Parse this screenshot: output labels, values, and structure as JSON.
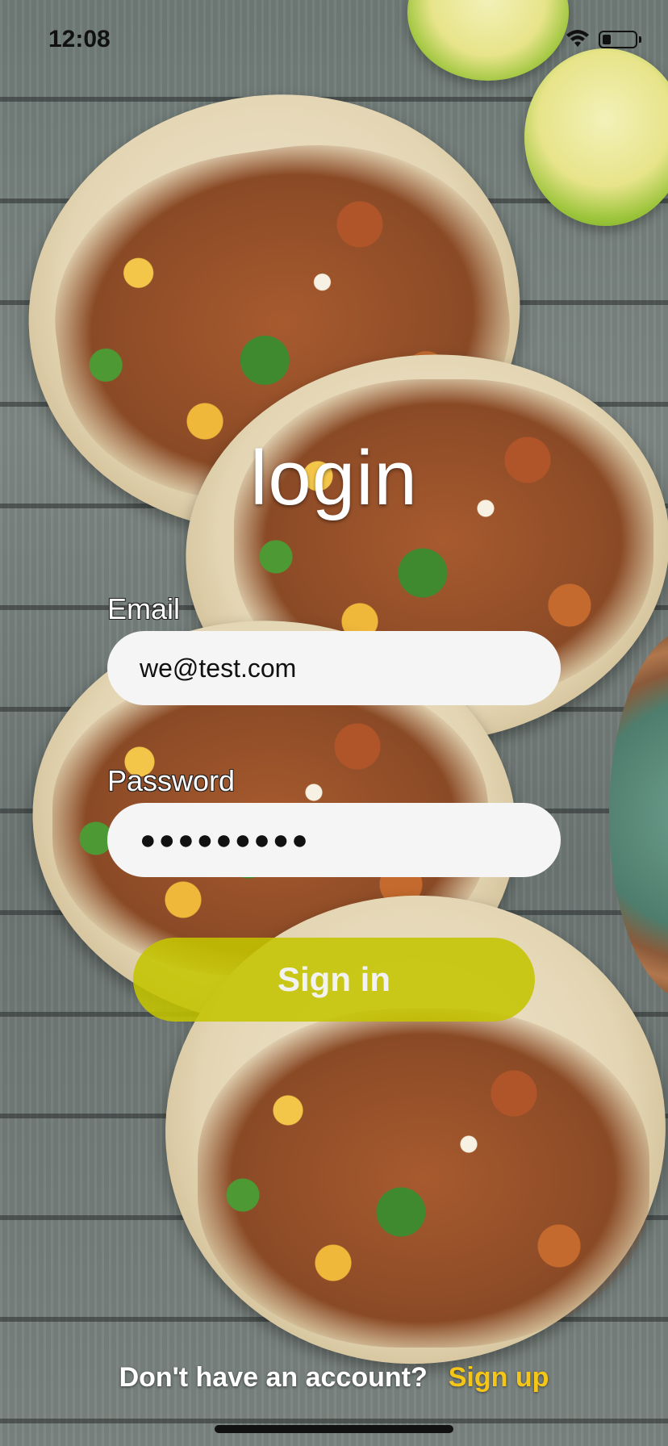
{
  "status_bar": {
    "time": "12:08",
    "wifi_icon": "wifi-icon",
    "battery_icon": "battery-icon"
  },
  "background": {
    "description_icon": "tacos-photo"
  },
  "login": {
    "title": "login",
    "email_label": "Email",
    "email_value": "we@test.com",
    "password_label": "Password",
    "password_value": "●●●●●●●●●",
    "signin_label": "Sign in"
  },
  "footer": {
    "prompt": "Don't have an account?",
    "signup_label": "Sign up"
  },
  "colors": {
    "signin_button": "#c4c400",
    "signup_link": "#f5c518",
    "field_background": "#f5f5f5"
  }
}
